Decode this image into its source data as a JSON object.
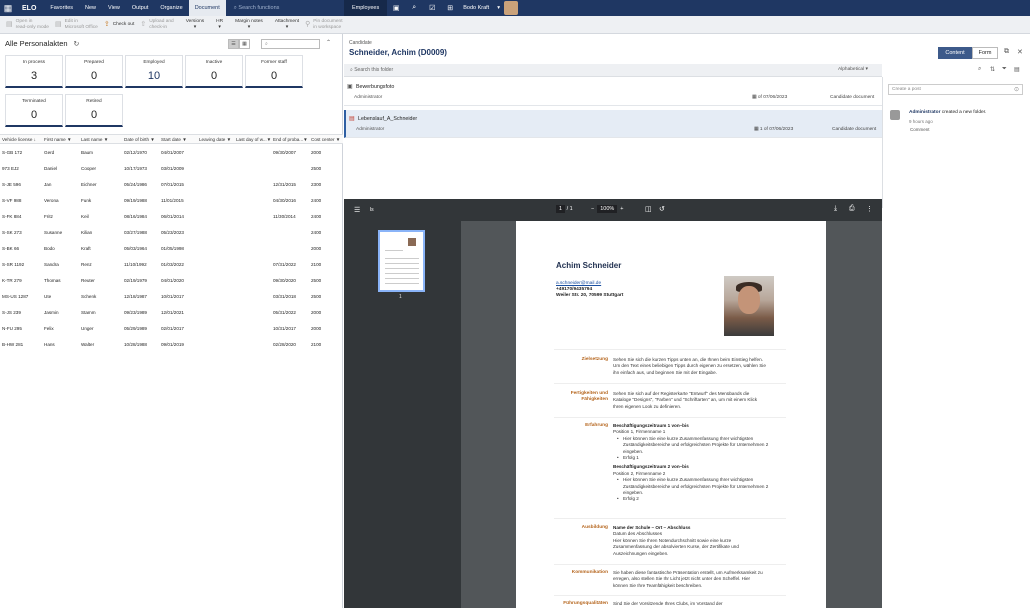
{
  "topbar": {
    "brand": "ELO",
    "nav": [
      "Favorites",
      "New",
      "View",
      "Output",
      "Organize",
      "Document"
    ],
    "active_nav": "Document",
    "search_placeholder": "Search functions",
    "employees": "Employees",
    "user_name": "Bodo Kraft"
  },
  "ribbon": {
    "open_readonly": [
      "Open in",
      "read-only mode"
    ],
    "edit_office": [
      "Edit in",
      "Microsoft Office"
    ],
    "check_out": "Check out",
    "upload": [
      "Upload and",
      "check-in"
    ],
    "versions": "Versions",
    "hr": "HR",
    "margin_notes": "Margin notes",
    "attachment": "Attachment",
    "pin": [
      "Pin document",
      "in workspace"
    ]
  },
  "left": {
    "title": "Alle Personalakten",
    "filter_placeholder": "",
    "tiles": [
      {
        "label": "In process",
        "value": "3"
      },
      {
        "label": "Prepared",
        "value": "0"
      },
      {
        "label": "Employed",
        "value": "10"
      },
      {
        "label": "Inactive",
        "value": "0"
      },
      {
        "label": "Former staff",
        "value": "0"
      },
      {
        "label": "Terminated",
        "value": "0"
      },
      {
        "label": "Retired",
        "value": "0"
      }
    ],
    "columns": [
      "Vehicle license ↓",
      "First name ▼",
      "Last name ▼",
      "Date of birth ▼",
      "Start date ▼",
      "Leaving date ▼",
      "Last day of w...▼",
      "End of proba...▼",
      "Cost center ▼"
    ],
    "rows": [
      [
        "S-GB 172",
        "Gerd",
        "Baum",
        "02/12/1970",
        "04/01/2007",
        "",
        "",
        "09/30/2007",
        "2000"
      ],
      [
        "973 EJ2",
        "Daniel",
        "Cooper",
        "10/17/1973",
        "03/01/2009",
        "",
        "",
        "",
        "2500"
      ],
      [
        "S-JE 596",
        "Jan",
        "Eichner",
        "05/24/1986",
        "07/01/2015",
        "",
        "",
        "12/31/2015",
        "2300"
      ],
      [
        "S-VF 988",
        "Verona",
        "Funk",
        "09/19/1988",
        "11/01/2015",
        "",
        "",
        "04/30/2016",
        "2400"
      ],
      [
        "S-FK 884",
        "Fritz",
        "Keil",
        "08/16/1984",
        "06/01/2014",
        "",
        "",
        "11/30/2014",
        "2400"
      ],
      [
        "S-SK 273",
        "Susanne",
        "Kilian",
        "03/27/1988",
        "05/23/2023",
        "",
        "",
        "",
        "2400"
      ],
      [
        "S-BK 66",
        "Bodo",
        "Kraft",
        "05/03/1964",
        "01/05/1998",
        "",
        "",
        "",
        "2000"
      ],
      [
        "S-SR 1192",
        "Sandra",
        "Renz",
        "11/10/1992",
        "01/03/2022",
        "",
        "",
        "07/31/2022",
        "2100"
      ],
      [
        "K-TR 279",
        "Thomas",
        "Reuter",
        "02/19/1979",
        "04/01/2020",
        "",
        "",
        "09/30/2020",
        "2500"
      ],
      [
        "MS-US 1287",
        "Ute",
        "Schenk",
        "12/18/1987",
        "10/01/2017",
        "",
        "",
        "03/31/2018",
        "2500"
      ],
      [
        "S-JS 239",
        "Jasmin",
        "Stamm",
        "09/23/1989",
        "12/01/2021",
        "",
        "",
        "05/31/2022",
        "2000"
      ],
      [
        "N-FU 295",
        "Felix",
        "Unger",
        "05/29/1989",
        "02/01/2017",
        "",
        "",
        "10/31/2017",
        "2000"
      ],
      [
        "B-HW 281",
        "Hans",
        "Walter",
        "10/28/1988",
        "09/01/2019",
        "",
        "",
        "02/28/2020",
        "2100"
      ]
    ]
  },
  "right": {
    "label": "Candidate",
    "title": "Schneider, Achim (D0009)",
    "content_btn": "Content",
    "form_btn": "Form",
    "search_folder": "Search this folder",
    "sort": "Alphabetical",
    "docs": [
      {
        "name": "Bewerbungsfoto",
        "author": "Administrator",
        "version": "of 07/06/2023",
        "type": "Candidate document"
      },
      {
        "name": "Lebenslauf_A_Schneider",
        "author": "Administrator",
        "version": "1 of 07/06/2023",
        "type": "Candidate document"
      }
    ],
    "feed": {
      "placeholder": "Create a post",
      "author": "Administrator",
      "action": "created a new folder.",
      "time": "9 hours ago",
      "comment": "Comment"
    }
  },
  "viewer": {
    "page_current": "1",
    "page_total": "/ 1",
    "zoom": "100%",
    "thumb_num": "1"
  },
  "cv": {
    "name": "Achim Schneider",
    "email": "a.schneider@mail.de",
    "phone": "+49170/9435794",
    "address": "Weiler Str. 20, 70599 Stuttgart",
    "sections": [
      {
        "label": "Zielsetzung",
        "lines": [
          "Sehen Sie sich die kurzen Tipps unten an, die Ihnen beim Einstieg helfen.",
          "Um den Text eines beliebigen Tipps durch eigenen zu ersetzen, wählen Sie",
          "ihn einfach aus, und beginnen Sie mit der Eingabe."
        ]
      },
      {
        "label": "Fertigkeiten und Fähigkeiten",
        "lines": [
          "Sehen Sie sich auf der Registerkarte \"Entwurf\" des Menübands die",
          "Kataloge \"Designs\", \"Farben\" und \"Schriftarten\" an, um mit einem Klick",
          "Ihren eigenen Look zu definieren."
        ]
      },
      {
        "label": "Erfahrung",
        "job1_head": "Beschäftigungszeitraum 1 von–bis",
        "job1_pos": "Position 1, Firmenname 1",
        "job1_b1": "Hier können Sie eine kurze Zusammenfassung Ihrer wichtigsten Zuständigkeitsbereiche und erfolgreichsten Projekte für Unternehmen 2 eingeben.",
        "job1_b2": "Erfolg 1",
        "job2_head": "Beschäftigungszeitraum 2 von–bis",
        "job2_pos": "Position 2, Firmenname 2",
        "job2_b1": "Hier können Sie eine kurze Zusammenfassung Ihrer wichtigsten Zuständigkeitsbereiche und erfolgreichsten Projekte für Unternehmen 2 eingeben.",
        "job2_b2": "Erfolg 2"
      },
      {
        "label": "Ausbildung",
        "head": "Name der Schule – Ort – Abschluss",
        "lines": [
          "Datum des Abschlusses",
          "Hier können Sie Ihren Notendurchschnitt sowie eine kurze",
          "Zusammenfassung der absolvierten Kurse, der Zertifikate und",
          "Auszeichnungen eingeben."
        ]
      },
      {
        "label": "Kommunikation",
        "lines": [
          "Sie haben diese fantastische Präsentation erstellt, um Aufmerksamkeit zu",
          "erregen, also stellen Sie Ihr Licht jetzt nicht unter den Scheffel. Hier",
          "können Sie Ihre Teamfähigkeit beschreiben."
        ]
      },
      {
        "label": "Führungsqualitäten",
        "lines": [
          "Sind Sie der Vorsitzende Ihres Clubs, im Vorstand der"
        ]
      }
    ]
  }
}
